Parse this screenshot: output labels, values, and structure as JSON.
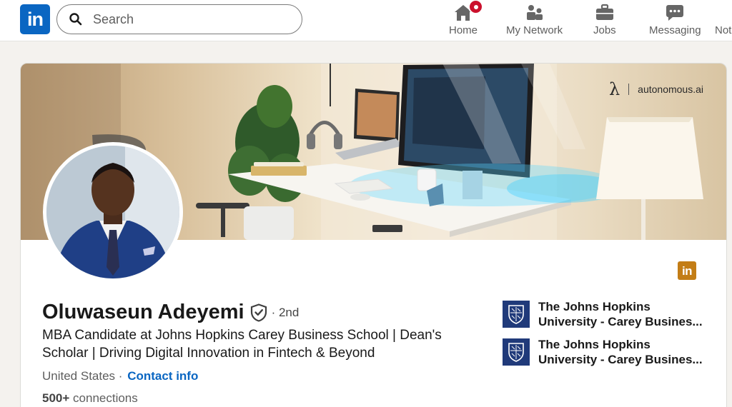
{
  "nav": {
    "logo_text": "in",
    "search_placeholder": "Search",
    "items": [
      {
        "label": "Home",
        "icon": "home-icon"
      },
      {
        "label": "My Network",
        "icon": "network-icon"
      },
      {
        "label": "Jobs",
        "icon": "briefcase-icon"
      },
      {
        "label": "Messaging",
        "icon": "messaging-icon"
      },
      {
        "label": "Not",
        "icon": "notifications-icon"
      }
    ]
  },
  "banner": {
    "brand": "autonomous.ai",
    "brand_symbol": "λ"
  },
  "profile": {
    "name": "Oluwaseun Adeyemi",
    "degree": "· 2nd",
    "headline": "MBA Candidate at Johns Hopkins Carey Business School | Dean's Scholar | Driving Digital Innovation in Fintech & Beyond",
    "location": "United States ·",
    "contact_info": "Contact info",
    "connections_count": "500+",
    "connections_label": "connections",
    "badge_text": "in"
  },
  "education": [
    {
      "line1": "The Johns Hopkins",
      "line2": "University - Carey Busines..."
    },
    {
      "line1": "The Johns Hopkins",
      "line2": "University - Carey Busines..."
    }
  ],
  "colors": {
    "brand_blue": "#0a66c2",
    "notification_red": "#cb112d",
    "premium_gold": "#c37d16",
    "jhu_navy": "#203a7a"
  }
}
